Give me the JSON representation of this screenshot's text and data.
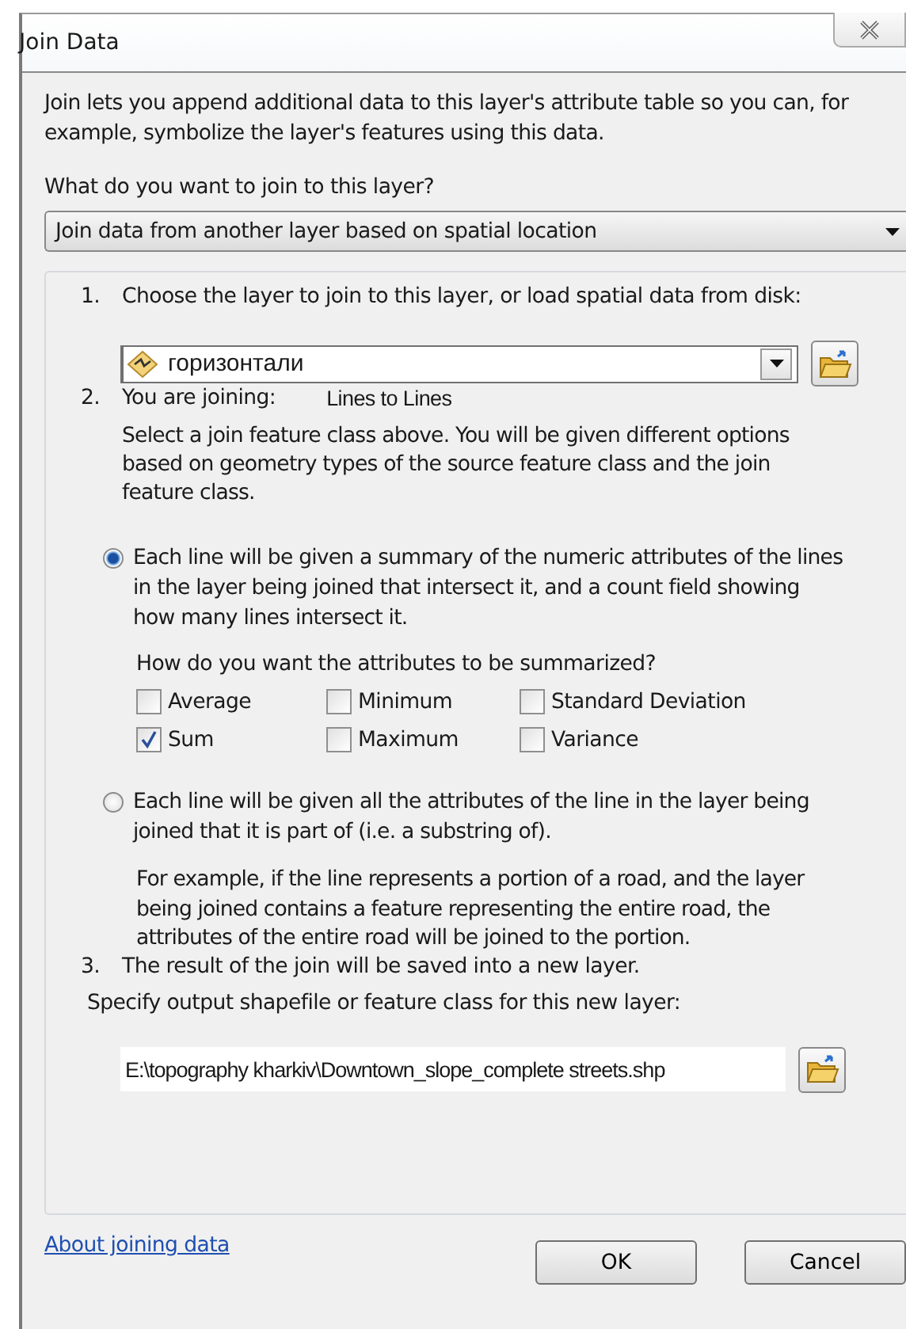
{
  "window": {
    "title": "Join Data"
  },
  "intro": "Join lets you append additional data to this layer's attribute table so you can, for example, symbolize the layer's features using this data.",
  "join_prompt": "What do you want to join to this layer?",
  "join_type": {
    "value": "Join data from another layer based on spatial location"
  },
  "step1": {
    "number": "1.",
    "label": "Choose the layer to join to this layer, or load spatial data from disk:",
    "layer": "горизонтали"
  },
  "step2": {
    "number": "2.",
    "label": "You are joining:",
    "joining": "Lines to Lines",
    "description": "Select a join feature class above.  You will be given different options based on geometry types of the source feature class and the join feature class."
  },
  "options": [
    {
      "selected": true,
      "text": "Each line will be given a summary of the numeric attributes of the lines in the layer being joined that intersect it, and a count field showing how many lines intersect it.",
      "summary_prompt": "How do you want the attributes to be summarized?",
      "statistics": [
        {
          "label": "Average",
          "checked": false
        },
        {
          "label": "Minimum",
          "checked": false
        },
        {
          "label": "Standard Deviation",
          "checked": false
        },
        {
          "label": "Sum",
          "checked": true
        },
        {
          "label": "Maximum",
          "checked": false
        },
        {
          "label": "Variance",
          "checked": false
        }
      ]
    },
    {
      "selected": false,
      "text": "Each line will be given all the attributes of the line in the layer being joined that it is part of (i.e. a substring of).",
      "note": "For example, if the line represents a portion of a road, and the layer being joined contains a feature representing the entire road, the attributes of the entire road will be joined to the portion."
    }
  ],
  "step3": {
    "number": "3.",
    "label": "The result of the join will be saved into a new layer.",
    "prompt": "Specify output shapefile or feature class for this new layer:",
    "output": "E:\\topography kharkiv\\Downtown_slope_complete streets.shp"
  },
  "help_link": "About joining data",
  "buttons": [
    "OK",
    "Cancel"
  ]
}
